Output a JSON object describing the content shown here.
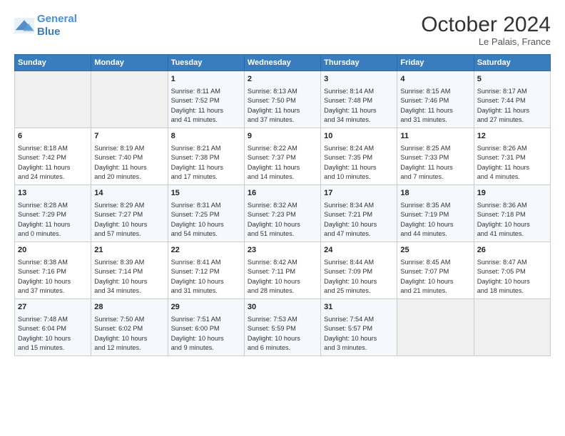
{
  "logo": {
    "line1": "General",
    "line2": "Blue"
  },
  "title": "October 2024",
  "location": "Le Palais, France",
  "header_days": [
    "Sunday",
    "Monday",
    "Tuesday",
    "Wednesday",
    "Thursday",
    "Friday",
    "Saturday"
  ],
  "weeks": [
    [
      {
        "day": "",
        "content": ""
      },
      {
        "day": "",
        "content": ""
      },
      {
        "day": "1",
        "content": "Sunrise: 8:11 AM\nSunset: 7:52 PM\nDaylight: 11 hours\nand 41 minutes."
      },
      {
        "day": "2",
        "content": "Sunrise: 8:13 AM\nSunset: 7:50 PM\nDaylight: 11 hours\nand 37 minutes."
      },
      {
        "day": "3",
        "content": "Sunrise: 8:14 AM\nSunset: 7:48 PM\nDaylight: 11 hours\nand 34 minutes."
      },
      {
        "day": "4",
        "content": "Sunrise: 8:15 AM\nSunset: 7:46 PM\nDaylight: 11 hours\nand 31 minutes."
      },
      {
        "day": "5",
        "content": "Sunrise: 8:17 AM\nSunset: 7:44 PM\nDaylight: 11 hours\nand 27 minutes."
      }
    ],
    [
      {
        "day": "6",
        "content": "Sunrise: 8:18 AM\nSunset: 7:42 PM\nDaylight: 11 hours\nand 24 minutes."
      },
      {
        "day": "7",
        "content": "Sunrise: 8:19 AM\nSunset: 7:40 PM\nDaylight: 11 hours\nand 20 minutes."
      },
      {
        "day": "8",
        "content": "Sunrise: 8:21 AM\nSunset: 7:38 PM\nDaylight: 11 hours\nand 17 minutes."
      },
      {
        "day": "9",
        "content": "Sunrise: 8:22 AM\nSunset: 7:37 PM\nDaylight: 11 hours\nand 14 minutes."
      },
      {
        "day": "10",
        "content": "Sunrise: 8:24 AM\nSunset: 7:35 PM\nDaylight: 11 hours\nand 10 minutes."
      },
      {
        "day": "11",
        "content": "Sunrise: 8:25 AM\nSunset: 7:33 PM\nDaylight: 11 hours\nand 7 minutes."
      },
      {
        "day": "12",
        "content": "Sunrise: 8:26 AM\nSunset: 7:31 PM\nDaylight: 11 hours\nand 4 minutes."
      }
    ],
    [
      {
        "day": "13",
        "content": "Sunrise: 8:28 AM\nSunset: 7:29 PM\nDaylight: 11 hours\nand 0 minutes."
      },
      {
        "day": "14",
        "content": "Sunrise: 8:29 AM\nSunset: 7:27 PM\nDaylight: 10 hours\nand 57 minutes."
      },
      {
        "day": "15",
        "content": "Sunrise: 8:31 AM\nSunset: 7:25 PM\nDaylight: 10 hours\nand 54 minutes."
      },
      {
        "day": "16",
        "content": "Sunrise: 8:32 AM\nSunset: 7:23 PM\nDaylight: 10 hours\nand 51 minutes."
      },
      {
        "day": "17",
        "content": "Sunrise: 8:34 AM\nSunset: 7:21 PM\nDaylight: 10 hours\nand 47 minutes."
      },
      {
        "day": "18",
        "content": "Sunrise: 8:35 AM\nSunset: 7:19 PM\nDaylight: 10 hours\nand 44 minutes."
      },
      {
        "day": "19",
        "content": "Sunrise: 8:36 AM\nSunset: 7:18 PM\nDaylight: 10 hours\nand 41 minutes."
      }
    ],
    [
      {
        "day": "20",
        "content": "Sunrise: 8:38 AM\nSunset: 7:16 PM\nDaylight: 10 hours\nand 37 minutes."
      },
      {
        "day": "21",
        "content": "Sunrise: 8:39 AM\nSunset: 7:14 PM\nDaylight: 10 hours\nand 34 minutes."
      },
      {
        "day": "22",
        "content": "Sunrise: 8:41 AM\nSunset: 7:12 PM\nDaylight: 10 hours\nand 31 minutes."
      },
      {
        "day": "23",
        "content": "Sunrise: 8:42 AM\nSunset: 7:11 PM\nDaylight: 10 hours\nand 28 minutes."
      },
      {
        "day": "24",
        "content": "Sunrise: 8:44 AM\nSunset: 7:09 PM\nDaylight: 10 hours\nand 25 minutes."
      },
      {
        "day": "25",
        "content": "Sunrise: 8:45 AM\nSunset: 7:07 PM\nDaylight: 10 hours\nand 21 minutes."
      },
      {
        "day": "26",
        "content": "Sunrise: 8:47 AM\nSunset: 7:05 PM\nDaylight: 10 hours\nand 18 minutes."
      }
    ],
    [
      {
        "day": "27",
        "content": "Sunrise: 7:48 AM\nSunset: 6:04 PM\nDaylight: 10 hours\nand 15 minutes."
      },
      {
        "day": "28",
        "content": "Sunrise: 7:50 AM\nSunset: 6:02 PM\nDaylight: 10 hours\nand 12 minutes."
      },
      {
        "day": "29",
        "content": "Sunrise: 7:51 AM\nSunset: 6:00 PM\nDaylight: 10 hours\nand 9 minutes."
      },
      {
        "day": "30",
        "content": "Sunrise: 7:53 AM\nSunset: 5:59 PM\nDaylight: 10 hours\nand 6 minutes."
      },
      {
        "day": "31",
        "content": "Sunrise: 7:54 AM\nSunset: 5:57 PM\nDaylight: 10 hours\nand 3 minutes."
      },
      {
        "day": "",
        "content": ""
      },
      {
        "day": "",
        "content": ""
      }
    ]
  ]
}
